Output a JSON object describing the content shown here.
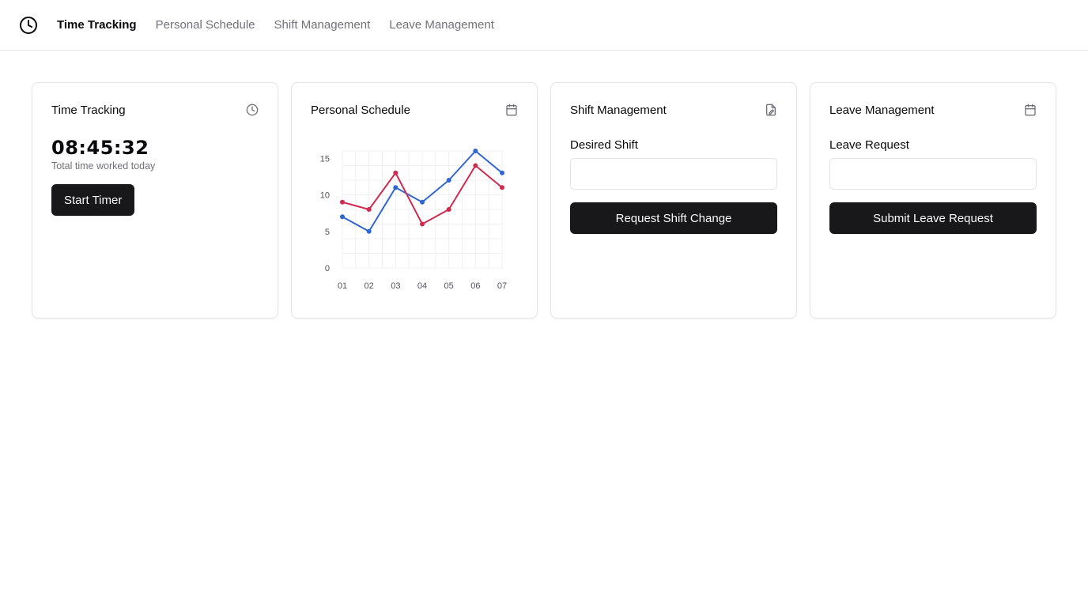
{
  "nav": {
    "items": [
      {
        "label": "Time Tracking",
        "active": true
      },
      {
        "label": "Personal Schedule",
        "active": false
      },
      {
        "label": "Shift Management",
        "active": false
      },
      {
        "label": "Leave Management",
        "active": false
      }
    ]
  },
  "time_tracking": {
    "title": "Time Tracking",
    "icon": "clock-icon",
    "timer": "08:45:32",
    "subtitle": "Total time worked today",
    "button": "Start Timer"
  },
  "personal_schedule": {
    "title": "Personal Schedule",
    "icon": "calendar-icon"
  },
  "shift_management": {
    "title": "Shift Management",
    "icon": "file-edit-icon",
    "field_label": "Desired Shift",
    "field_value": "",
    "field_placeholder": "",
    "button": "Request Shift Change"
  },
  "leave_management": {
    "title": "Leave Management",
    "icon": "calendar-icon",
    "field_label": "Leave Request",
    "field_value": "",
    "field_placeholder": "",
    "button": "Submit Leave Request"
  },
  "chart_data": {
    "type": "line",
    "categories": [
      "01",
      "02",
      "03",
      "04",
      "05",
      "06",
      "07"
    ],
    "y_ticks": [
      0,
      5,
      10,
      15
    ],
    "ylim": [
      0,
      16
    ],
    "grid": true,
    "series": [
      {
        "color": "#3066d0",
        "values": [
          7,
          5,
          11,
          9,
          12,
          16,
          13
        ]
      },
      {
        "color": "#cf2b4f",
        "values": [
          9,
          8,
          13,
          6,
          8,
          14,
          11
        ]
      }
    ]
  },
  "colors": {
    "primary": "#18181b",
    "muted": "#71717a",
    "border": "#e4e4e7"
  }
}
